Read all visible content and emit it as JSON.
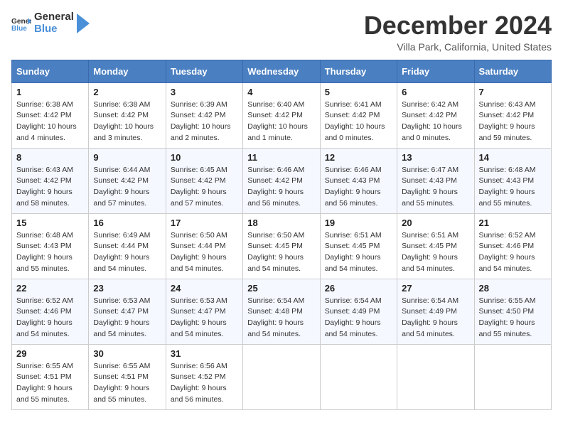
{
  "logo": {
    "general": "General",
    "blue": "Blue"
  },
  "header": {
    "month": "December 2024",
    "location": "Villa Park, California, United States"
  },
  "weekdays": [
    "Sunday",
    "Monday",
    "Tuesday",
    "Wednesday",
    "Thursday",
    "Friday",
    "Saturday"
  ],
  "weeks": [
    [
      {
        "day": "1",
        "sunrise": "6:38 AM",
        "sunset": "4:42 PM",
        "daylight": "10 hours and 4 minutes."
      },
      {
        "day": "2",
        "sunrise": "6:38 AM",
        "sunset": "4:42 PM",
        "daylight": "10 hours and 3 minutes."
      },
      {
        "day": "3",
        "sunrise": "6:39 AM",
        "sunset": "4:42 PM",
        "daylight": "10 hours and 2 minutes."
      },
      {
        "day": "4",
        "sunrise": "6:40 AM",
        "sunset": "4:42 PM",
        "daylight": "10 hours and 1 minute."
      },
      {
        "day": "5",
        "sunrise": "6:41 AM",
        "sunset": "4:42 PM",
        "daylight": "10 hours and 0 minutes."
      },
      {
        "day": "6",
        "sunrise": "6:42 AM",
        "sunset": "4:42 PM",
        "daylight": "10 hours and 0 minutes."
      },
      {
        "day": "7",
        "sunrise": "6:43 AM",
        "sunset": "4:42 PM",
        "daylight": "9 hours and 59 minutes."
      }
    ],
    [
      {
        "day": "8",
        "sunrise": "6:43 AM",
        "sunset": "4:42 PM",
        "daylight": "9 hours and 58 minutes."
      },
      {
        "day": "9",
        "sunrise": "6:44 AM",
        "sunset": "4:42 PM",
        "daylight": "9 hours and 57 minutes."
      },
      {
        "day": "10",
        "sunrise": "6:45 AM",
        "sunset": "4:42 PM",
        "daylight": "9 hours and 57 minutes."
      },
      {
        "day": "11",
        "sunrise": "6:46 AM",
        "sunset": "4:42 PM",
        "daylight": "9 hours and 56 minutes."
      },
      {
        "day": "12",
        "sunrise": "6:46 AM",
        "sunset": "4:43 PM",
        "daylight": "9 hours and 56 minutes."
      },
      {
        "day": "13",
        "sunrise": "6:47 AM",
        "sunset": "4:43 PM",
        "daylight": "9 hours and 55 minutes."
      },
      {
        "day": "14",
        "sunrise": "6:48 AM",
        "sunset": "4:43 PM",
        "daylight": "9 hours and 55 minutes."
      }
    ],
    [
      {
        "day": "15",
        "sunrise": "6:48 AM",
        "sunset": "4:43 PM",
        "daylight": "9 hours and 55 minutes."
      },
      {
        "day": "16",
        "sunrise": "6:49 AM",
        "sunset": "4:44 PM",
        "daylight": "9 hours and 54 minutes."
      },
      {
        "day": "17",
        "sunrise": "6:50 AM",
        "sunset": "4:44 PM",
        "daylight": "9 hours and 54 minutes."
      },
      {
        "day": "18",
        "sunrise": "6:50 AM",
        "sunset": "4:45 PM",
        "daylight": "9 hours and 54 minutes."
      },
      {
        "day": "19",
        "sunrise": "6:51 AM",
        "sunset": "4:45 PM",
        "daylight": "9 hours and 54 minutes."
      },
      {
        "day": "20",
        "sunrise": "6:51 AM",
        "sunset": "4:45 PM",
        "daylight": "9 hours and 54 minutes."
      },
      {
        "day": "21",
        "sunrise": "6:52 AM",
        "sunset": "4:46 PM",
        "daylight": "9 hours and 54 minutes."
      }
    ],
    [
      {
        "day": "22",
        "sunrise": "6:52 AM",
        "sunset": "4:46 PM",
        "daylight": "9 hours and 54 minutes."
      },
      {
        "day": "23",
        "sunrise": "6:53 AM",
        "sunset": "4:47 PM",
        "daylight": "9 hours and 54 minutes."
      },
      {
        "day": "24",
        "sunrise": "6:53 AM",
        "sunset": "4:47 PM",
        "daylight": "9 hours and 54 minutes."
      },
      {
        "day": "25",
        "sunrise": "6:54 AM",
        "sunset": "4:48 PM",
        "daylight": "9 hours and 54 minutes."
      },
      {
        "day": "26",
        "sunrise": "6:54 AM",
        "sunset": "4:49 PM",
        "daylight": "9 hours and 54 minutes."
      },
      {
        "day": "27",
        "sunrise": "6:54 AM",
        "sunset": "4:49 PM",
        "daylight": "9 hours and 54 minutes."
      },
      {
        "day": "28",
        "sunrise": "6:55 AM",
        "sunset": "4:50 PM",
        "daylight": "9 hours and 55 minutes."
      }
    ],
    [
      {
        "day": "29",
        "sunrise": "6:55 AM",
        "sunset": "4:51 PM",
        "daylight": "9 hours and 55 minutes."
      },
      {
        "day": "30",
        "sunrise": "6:55 AM",
        "sunset": "4:51 PM",
        "daylight": "9 hours and 55 minutes."
      },
      {
        "day": "31",
        "sunrise": "6:56 AM",
        "sunset": "4:52 PM",
        "daylight": "9 hours and 56 minutes."
      },
      null,
      null,
      null,
      null
    ]
  ],
  "labels": {
    "sunrise": "Sunrise:",
    "sunset": "Sunset:",
    "daylight": "Daylight:"
  }
}
